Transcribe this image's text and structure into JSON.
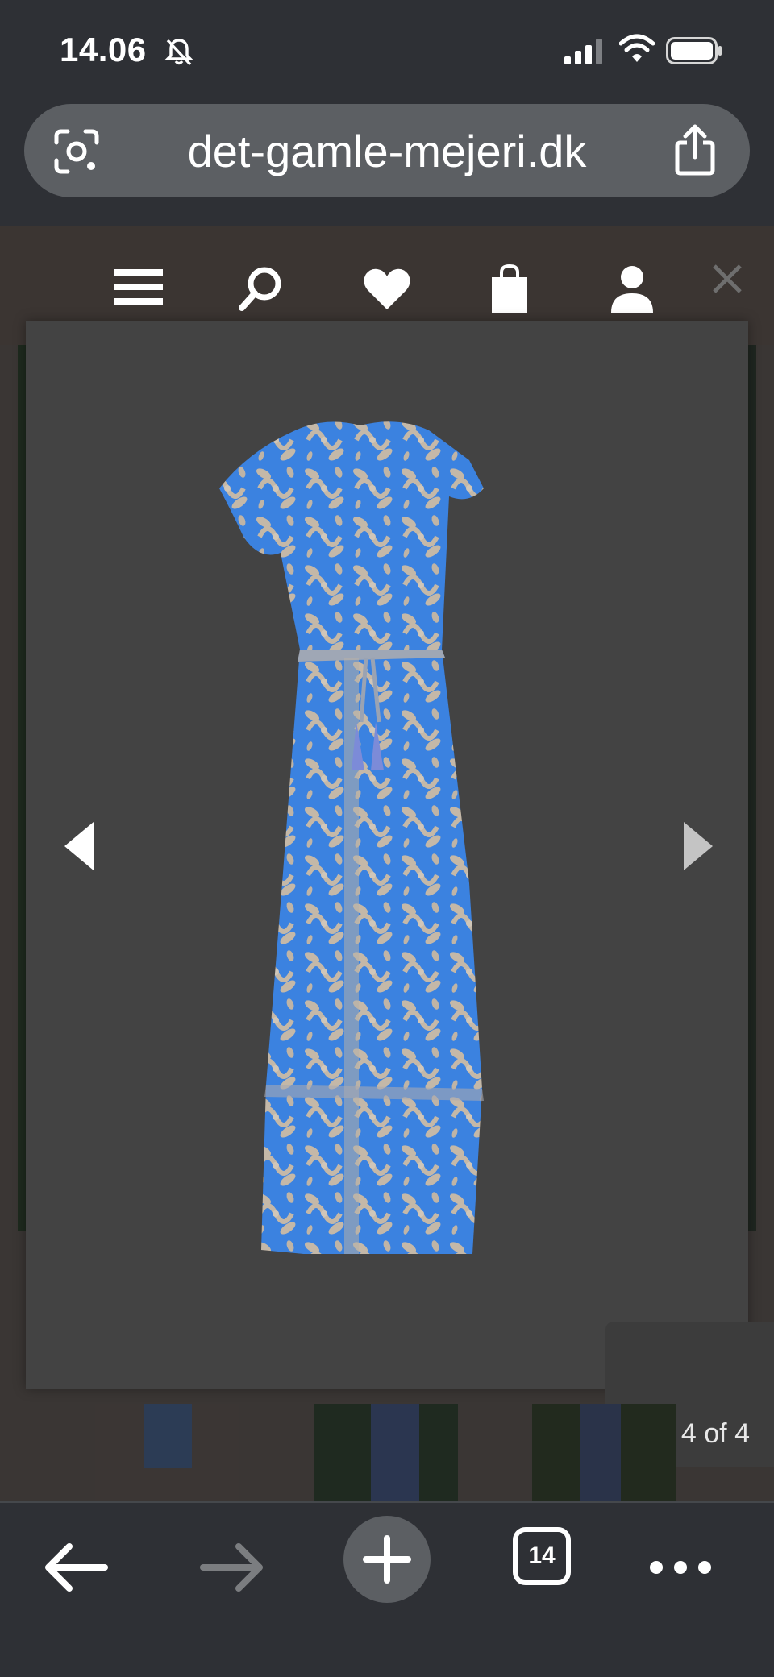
{
  "status_bar": {
    "time": "14.06",
    "silent_icon": "bell-slash-icon",
    "signal_icon": "cellular-signal-icon",
    "wifi_icon": "wifi-icon",
    "battery_icon": "battery-icon"
  },
  "browser": {
    "url": "det-gamle-mejeri.dk",
    "lens_icon": "camera-lens-icon",
    "share_icon": "share-icon"
  },
  "site_header": {
    "icons": [
      "menu-icon",
      "search-icon",
      "heart-icon",
      "shopping-bag-icon",
      "user-icon",
      "close-icon"
    ]
  },
  "lightbox": {
    "image": "blue floral dress back view",
    "counter": "4 of 4",
    "prev_icon": "chevron-left-icon",
    "next_icon": "chevron-right-icon",
    "colors": {
      "backdrop": "#434343",
      "dress_blue": "#3b82e0",
      "dress_beige": "#c4b8a8"
    }
  },
  "bottom_toolbar": {
    "back_icon": "arrow-left-icon",
    "forward_icon": "arrow-right-icon",
    "new_tab_icon": "plus-icon",
    "tab_count": "14",
    "more_icon": "more-icon"
  }
}
